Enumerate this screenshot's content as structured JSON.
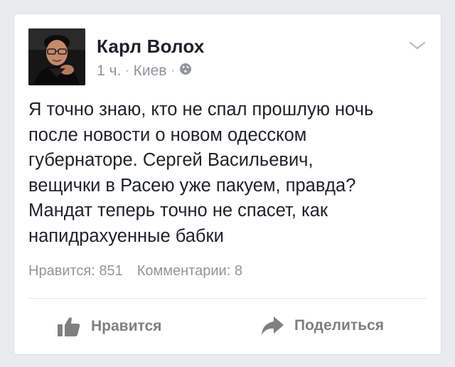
{
  "post": {
    "author": "Карл Волох",
    "time": "1 ч.",
    "location": "Киев",
    "separator": "·",
    "privacy_icon": "globe-icon",
    "text_lines": [
      "Я точно знаю, кто не спал прошлую ночь",
      "после новости о новом одесском",
      "губернаторе. Сергей Васильевич,",
      "вещички в Расею уже пакуем, правда?",
      "Мандат теперь точно не спасет, как",
      "напидрахуенные бабки"
    ]
  },
  "stats": {
    "likes": "Нравится: 851",
    "comments": "Комментарии: 8"
  },
  "actions": {
    "like_label": "Нравится",
    "like_icon": "thumbs-up-icon",
    "share_label": "Поделиться",
    "share_icon": "share-arrow-icon"
  },
  "colors": {
    "background": "#e9eaee",
    "card": "#ffffff",
    "name": "#1d2129",
    "secondary": "#90949c",
    "action": "#7f7f7f"
  }
}
